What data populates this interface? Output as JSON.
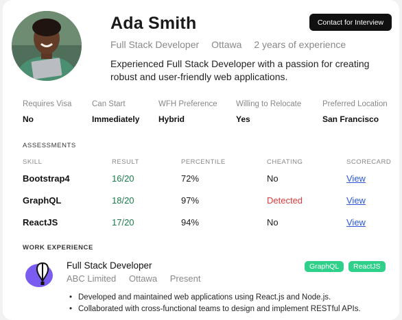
{
  "profile": {
    "name": "Ada Smith",
    "role": "Full Stack Developer",
    "location": "Ottawa",
    "experience": "2 years of experience",
    "bio": "Experienced Full Stack Developer with a passion for creating robust and user-friendly web applications."
  },
  "contact_button": "Contact for Interview",
  "facts": [
    {
      "label": "Requires Visa",
      "value": "No"
    },
    {
      "label": "Can Start",
      "value": "Immediately"
    },
    {
      "label": "WFH Preference",
      "value": "Hybrid"
    },
    {
      "label": "Willing to Relocate",
      "value": "Yes"
    },
    {
      "label": "Preferred Location",
      "value": "San Francisco"
    }
  ],
  "assessments": {
    "title": "ASSESSMENTS",
    "headers": [
      "SKILL",
      "RESULT",
      "PERCENTILE",
      "CHEATING",
      "SCORECARD"
    ],
    "rows": [
      {
        "skill": "Bootstrap4",
        "result": "16/20",
        "percentile": "72%",
        "cheating": "No",
        "scorecard": "View"
      },
      {
        "skill": "GraphQL",
        "result": "18/20",
        "percentile": "97%",
        "cheating": "Detected",
        "scorecard": "View"
      },
      {
        "skill": "ReactJS",
        "result": "17/20",
        "percentile": "94%",
        "cheating": "No",
        "scorecard": "View"
      }
    ]
  },
  "work": {
    "title": "WORK EXPERIENCE",
    "job_title": "Full Stack Developer",
    "company": "ABC Limited",
    "location": "Ottawa",
    "period": "Present",
    "tags": [
      "GraphQL",
      "ReactJS"
    ],
    "bullets": [
      "Developed and maintained web applications using React.js and Node.js.",
      "Collaborated with cross-functional teams to design and implement RESTful APIs."
    ]
  },
  "colors": {
    "accent_green": "#2fd08a",
    "result_green": "#1c7a4a",
    "alert_red": "#d93b3b",
    "link_blue": "#2a55d8",
    "button_dark": "#111111"
  }
}
